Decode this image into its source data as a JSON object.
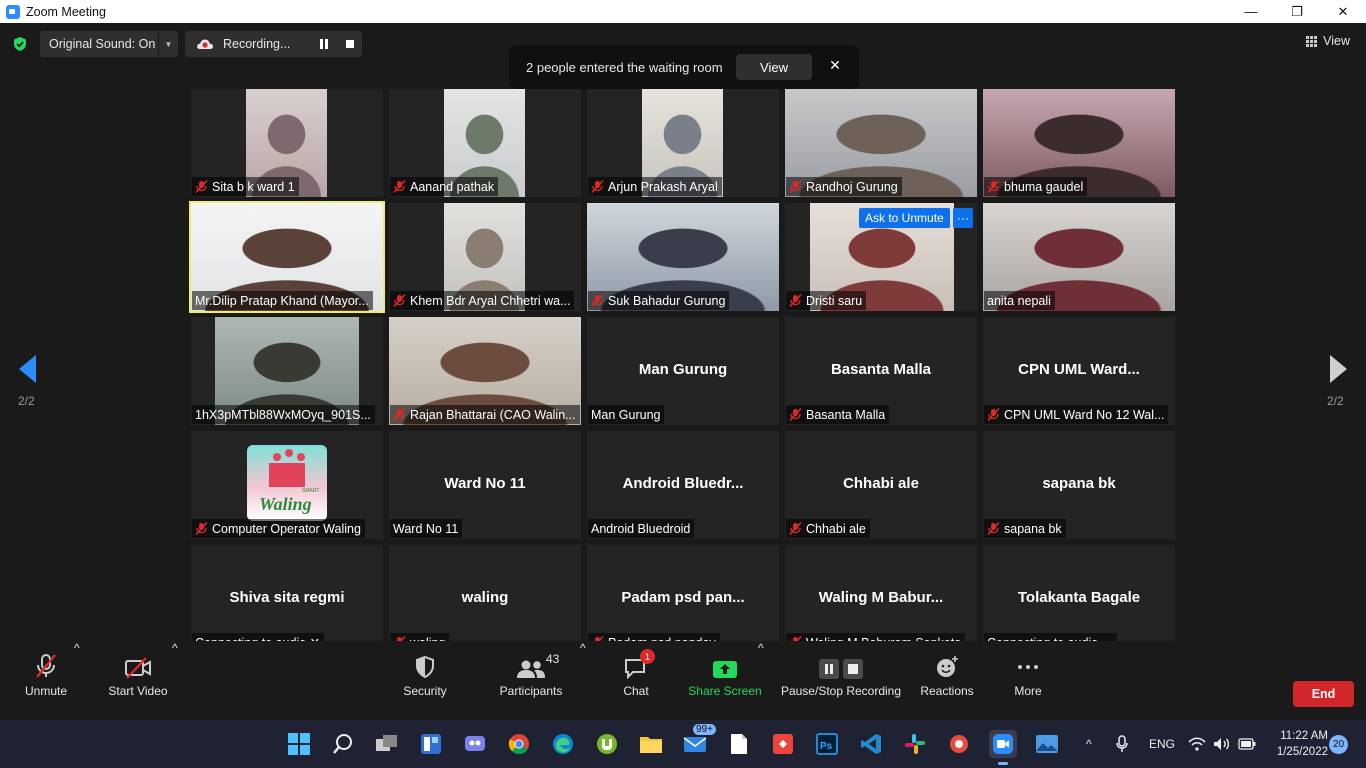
{
  "window": {
    "title": "Zoom Meeting",
    "minimize": "—",
    "restore": "❐",
    "close": "✕"
  },
  "topbar": {
    "original_sound": "Original Sound: On",
    "recording_label": "Recording...",
    "view_label": "View"
  },
  "waiting_room": {
    "message": "2 people entered the waiting room",
    "view_button": "View",
    "close": "✕"
  },
  "pagination": {
    "left": "2/2",
    "right": "2/2"
  },
  "tiles": [
    {
      "label": "Sita b k ward 1",
      "muted": true,
      "video": true
    },
    {
      "label": "Aanand pathak",
      "muted": true,
      "video": true
    },
    {
      "label": "Arjun Prakash Aryal",
      "muted": true,
      "video": true
    },
    {
      "label": "Randhoj Gurung",
      "muted": true,
      "video": true
    },
    {
      "label": "bhuma gaudel",
      "muted": true,
      "video": true
    },
    {
      "label": "Mr.Dilip Pratap Khand (Mayor...",
      "muted": false,
      "video": true,
      "active": true
    },
    {
      "label": "Khem Bdr Aryal Chhetri wa...",
      "muted": true,
      "video": true
    },
    {
      "label": "Suk Bahadur Gurung",
      "muted": true,
      "video": true
    },
    {
      "label": "Dristi saru",
      "muted": true,
      "video": true,
      "ask_unmute": "Ask to Unmute",
      "more": "···"
    },
    {
      "label": "anita nepali",
      "muted": false,
      "video": true
    },
    {
      "label": "1hX3pMTbl88WxMOyq_901S...",
      "muted": false,
      "video": true
    },
    {
      "label": "Rajan Bhattarai (CAO Walin...",
      "muted": true,
      "video": true
    },
    {
      "label": "Man Gurung",
      "muted": false,
      "bigname": "Man Gurung"
    },
    {
      "label": "Basanta Malla",
      "muted": true,
      "bigname": "Basanta Malla"
    },
    {
      "label": "CPN UML Ward No 12 Wal...",
      "muted": true,
      "bigname": "CPN  UML  Ward..."
    },
    {
      "label": "Computer Operator Waling",
      "muted": true,
      "video": true,
      "logo": "Waling",
      "logo_small": "SMART"
    },
    {
      "label": "Ward No 11",
      "muted": false,
      "bigname": "Ward No 11"
    },
    {
      "label": "Android Bluedroid",
      "muted": false,
      "bigname": "Android  Bluedr..."
    },
    {
      "label": "Chhabi ale",
      "muted": true,
      "bigname": "Chhabi ale"
    },
    {
      "label": "sapana bk",
      "muted": true,
      "bigname": "sapana bk"
    },
    {
      "label": "Connecting to audio ✕",
      "muted": false,
      "bigname": "Shiva sita regmi"
    },
    {
      "label": "waling",
      "muted": true,
      "bigname": "waling"
    },
    {
      "label": "Padam psd panday",
      "muted": true,
      "bigname": "Padam  psd  pan..."
    },
    {
      "label": "Waling M Baburam Sapkota",
      "muted": true,
      "bigname": "Waling  M  Babur..."
    },
    {
      "label": "Connecting to audio ·..",
      "muted": false,
      "bigname": "Tolakanta Bagale"
    }
  ],
  "toolbar": {
    "unmute": "Unmute",
    "start_video": "Start Video",
    "security": "Security",
    "participants": "Participants",
    "participants_count": "43",
    "chat": "Chat",
    "chat_badge": "1",
    "share_screen": "Share Screen",
    "pause_stop_recording": "Pause/Stop Recording",
    "reactions": "Reactions",
    "more": "More",
    "end": "End",
    "caret": "^"
  },
  "taskbar": {
    "mail_badge": "99+",
    "language": "ENG",
    "time": "11:22 AM",
    "date": "1/25/2022",
    "notifications": "20",
    "tray_up": "^"
  },
  "colors": {
    "accent": "#2d8cff",
    "end_red": "#d1272b",
    "share_green": "#23d959",
    "active_border": "#f0ec6e",
    "muted_red": "#e02828"
  }
}
